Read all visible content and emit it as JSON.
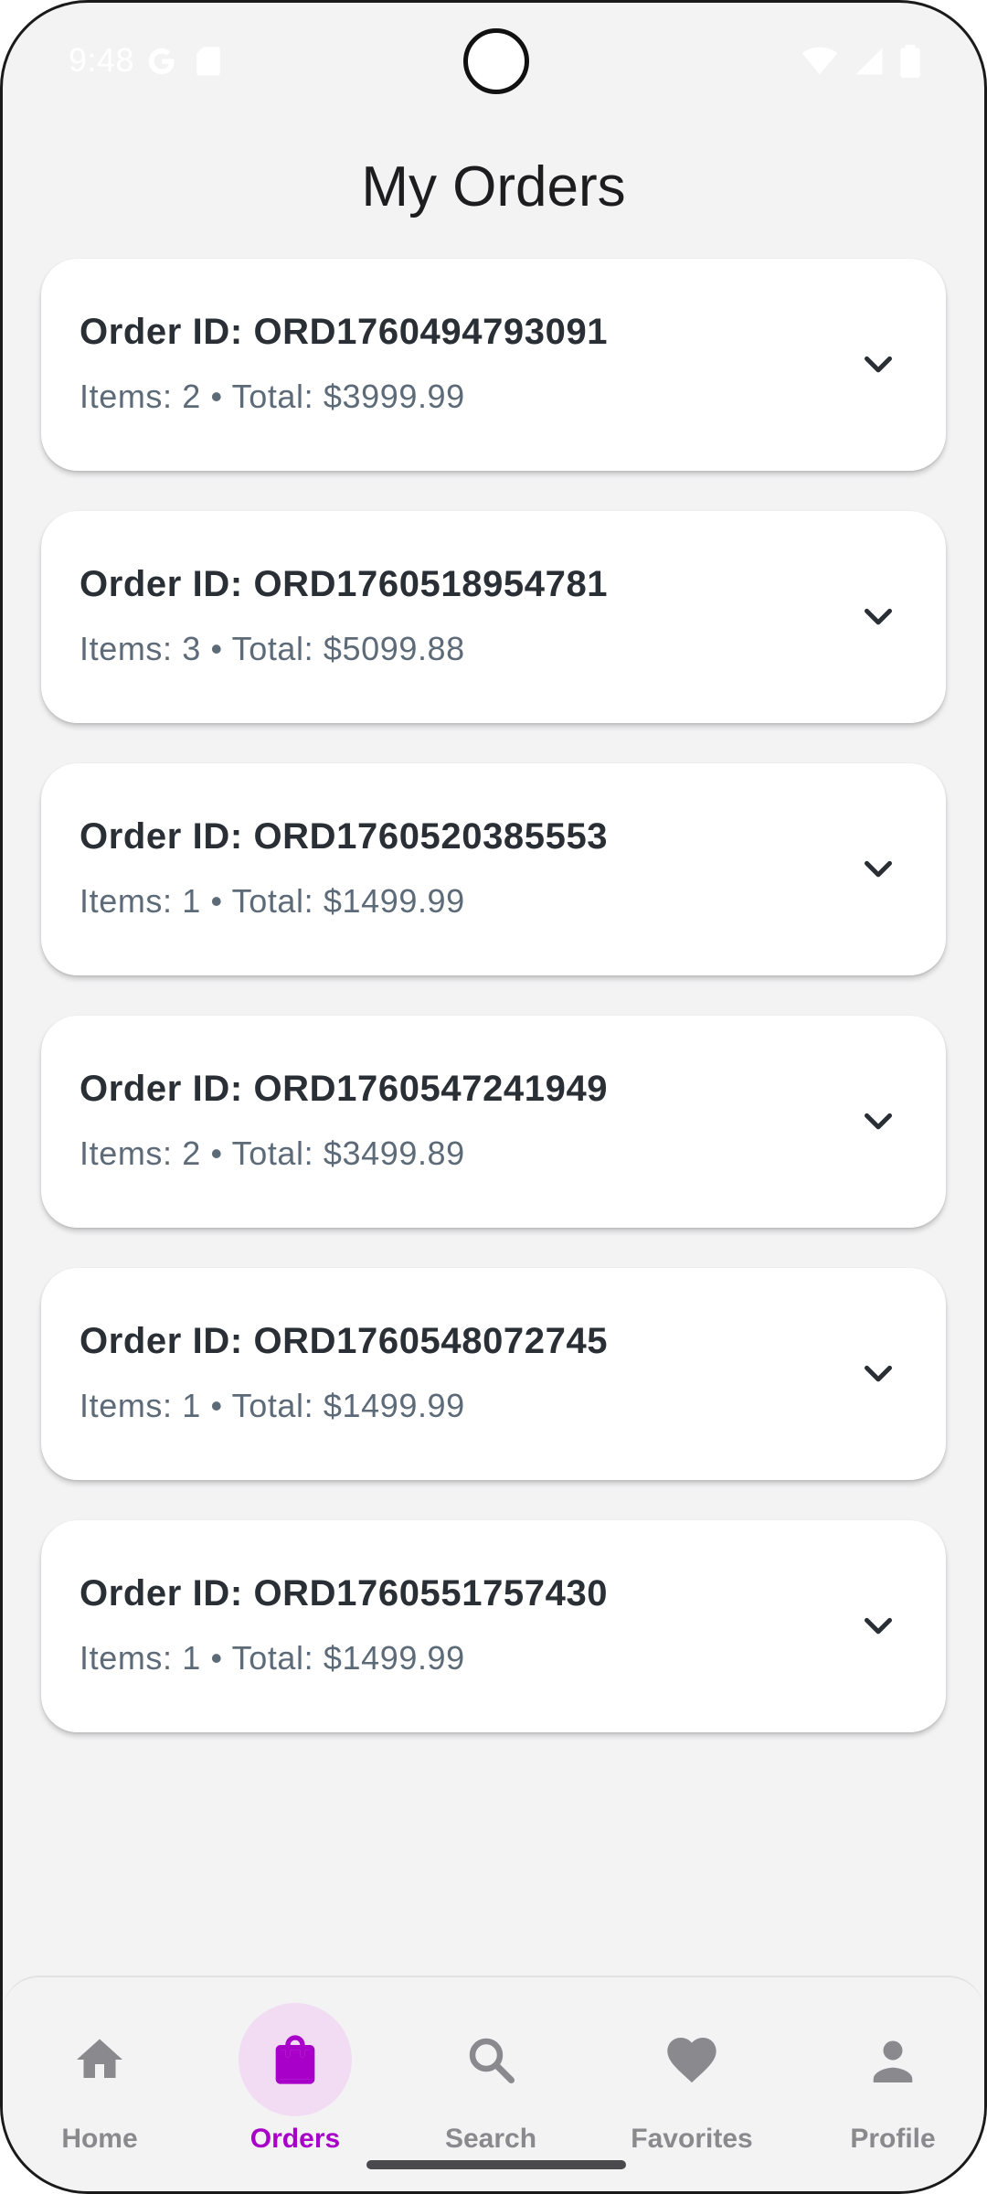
{
  "status_bar": {
    "time": "9:48"
  },
  "header": {
    "title": "My Orders"
  },
  "orders": [
    {
      "id_label": "Order ID: ORD1760494793091",
      "summary": "Items: 2 • Total: $3999.99"
    },
    {
      "id_label": "Order ID: ORD1760518954781",
      "summary": "Items: 3 • Total: $5099.88"
    },
    {
      "id_label": "Order ID: ORD1760520385553",
      "summary": "Items: 1 • Total: $1499.99"
    },
    {
      "id_label": "Order ID: ORD1760547241949",
      "summary": "Items: 2 • Total: $3499.89"
    },
    {
      "id_label": "Order ID: ORD1760548072745",
      "summary": "Items: 1 • Total: $1499.99"
    },
    {
      "id_label": "Order ID: ORD1760551757430",
      "summary": "Items: 1 • Total: $1499.99"
    }
  ],
  "bottom_nav": {
    "items": [
      {
        "label": "Home",
        "icon": "home-icon"
      },
      {
        "label": "Orders",
        "icon": "shopping-bag-icon",
        "active": true
      },
      {
        "label": "Search",
        "icon": "search-icon"
      },
      {
        "label": "Favorites",
        "icon": "heart-icon"
      },
      {
        "label": "Profile",
        "icon": "person-icon"
      }
    ]
  },
  "colors": {
    "accent": "#a800c8",
    "accent_bg": "#f1dcf4",
    "background": "#f3f3f4",
    "card": "#ffffff",
    "inactive_nav": "#8a8a8e"
  }
}
